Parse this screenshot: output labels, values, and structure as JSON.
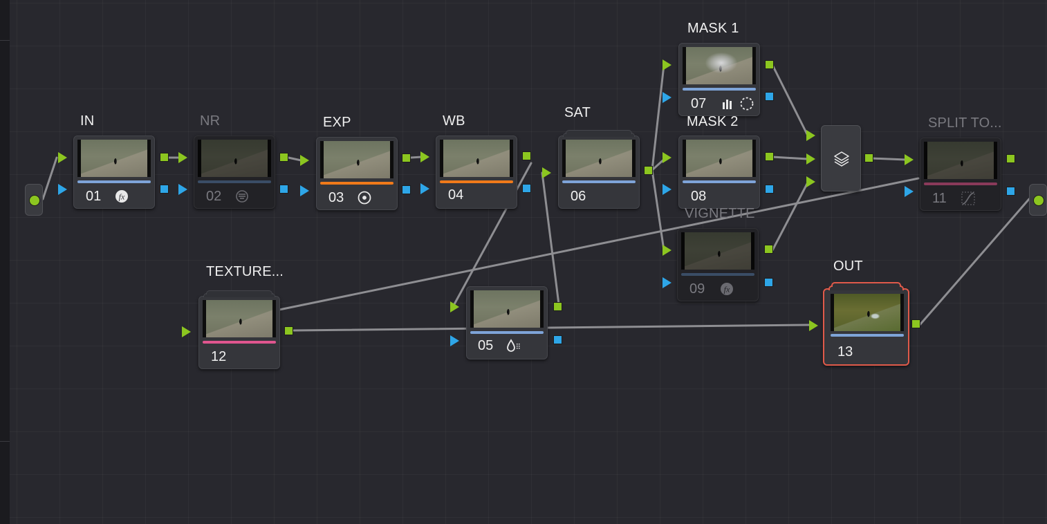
{
  "nodes": [
    {
      "id": "n01",
      "label": "IN",
      "number": "01",
      "icon": "fx-icon",
      "bar_color": "#7ea4d8",
      "disabled": false
    },
    {
      "id": "n02",
      "label": "NR",
      "number": "02",
      "icon": "noise-reduction-icon",
      "bar_color": "#3a4d66",
      "disabled": true
    },
    {
      "id": "n03",
      "label": "EXP",
      "number": "03",
      "icon": "circle-dot-icon",
      "bar_color": "#f07a1a",
      "disabled": false
    },
    {
      "id": "n04",
      "label": "WB",
      "number": "04",
      "icon": "",
      "bar_color": "#f07a1a",
      "disabled": false
    },
    {
      "id": "n05",
      "label": "",
      "number": "05",
      "icon": "water-drop-icon",
      "bar_color": "#7ea4d8",
      "disabled": false
    },
    {
      "id": "n06",
      "label": "SAT",
      "number": "06",
      "icon": "",
      "bar_color": "#7ea4d8",
      "disabled": false
    },
    {
      "id": "n07",
      "label": "MASK 1",
      "number": "07",
      "icon": "bars-window-icon",
      "bar_color": "#7ea4d8",
      "disabled": false
    },
    {
      "id": "n08",
      "label": "MASK 2",
      "number": "08",
      "icon": "",
      "bar_color": "#7ea4d8",
      "disabled": false
    },
    {
      "id": "n09",
      "label": "VIGNETTE",
      "number": "09",
      "icon": "fx-icon",
      "bar_color": "#3a4d66",
      "disabled": true
    },
    {
      "id": "n11",
      "label": "SPLIT TO...",
      "number": "11",
      "icon": "curves-icon",
      "bar_color": "#8a3a5a",
      "disabled": true
    },
    {
      "id": "n12",
      "label": "TEXTURE...",
      "number": "12",
      "icon": "",
      "bar_color": "#e0558e",
      "disabled": false
    },
    {
      "id": "n13",
      "label": "OUT",
      "number": "13",
      "icon": "",
      "bar_color": "#7ea4d8",
      "disabled": false
    }
  ],
  "layer_mixer": {
    "icon": "layers-icon"
  },
  "colors": {
    "rgb_port": "#8cc620",
    "alpha_port": "#2ea6e8",
    "wire": "#8e8e92",
    "selected_outline": "#e05a4a"
  }
}
